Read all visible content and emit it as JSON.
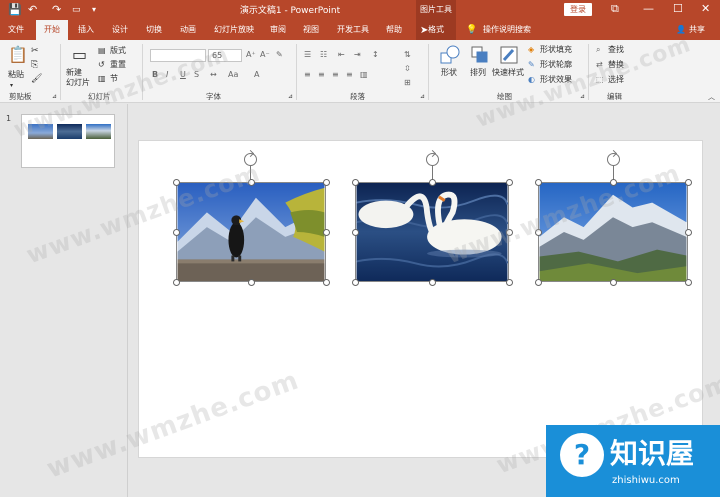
{
  "titlebar": {
    "icons": [
      "save-icon",
      "undo-icon",
      "redo-icon",
      "start-from-beginning-icon",
      "customize-icon"
    ],
    "title": "演示文稿1 - PowerPoint",
    "tool_context": "图片工具",
    "login": "登录",
    "restore": "⧉",
    "minimize": "—",
    "maximize": "☐",
    "close": "✕"
  },
  "tabs": [
    "文件",
    "开始",
    "插入",
    "设计",
    "切换",
    "动画",
    "幻灯片放映",
    "审阅",
    "视图",
    "开发工具",
    "帮助",
    "格式"
  ],
  "tellme": "操作说明搜索",
  "share": "共享",
  "ribbon": {
    "clipboard": {
      "paste": "粘贴",
      "group": "剪贴板"
    },
    "slides": {
      "new_slide": "新建\n幻灯片",
      "layout": "版式",
      "reset": "重置",
      "section": "节",
      "group": "幻灯片"
    },
    "font": {
      "size": "65",
      "bold": "B",
      "italic": "I",
      "underline": "U",
      "strike": "S",
      "group": "字体"
    },
    "paragraph": {
      "group": "段落"
    },
    "drawing": {
      "shapes": "形状",
      "arrange": "排列",
      "quick_styles": "快速样式",
      "fill": "形状填充",
      "outline": "形状轮廓",
      "effects": "形状效果",
      "group": "绘图"
    },
    "editing": {
      "find": "查找",
      "replace": "替换",
      "select": "选择",
      "group": "编辑"
    }
  },
  "slide_number": "1",
  "watermark": "www.wmzhe.com",
  "logo": {
    "title": "知识屋",
    "url": "zhishiwu.com",
    "glyph": "?"
  },
  "pictures": [
    "eagle-on-rock-photo",
    "swans-photo",
    "mountains-photo"
  ]
}
